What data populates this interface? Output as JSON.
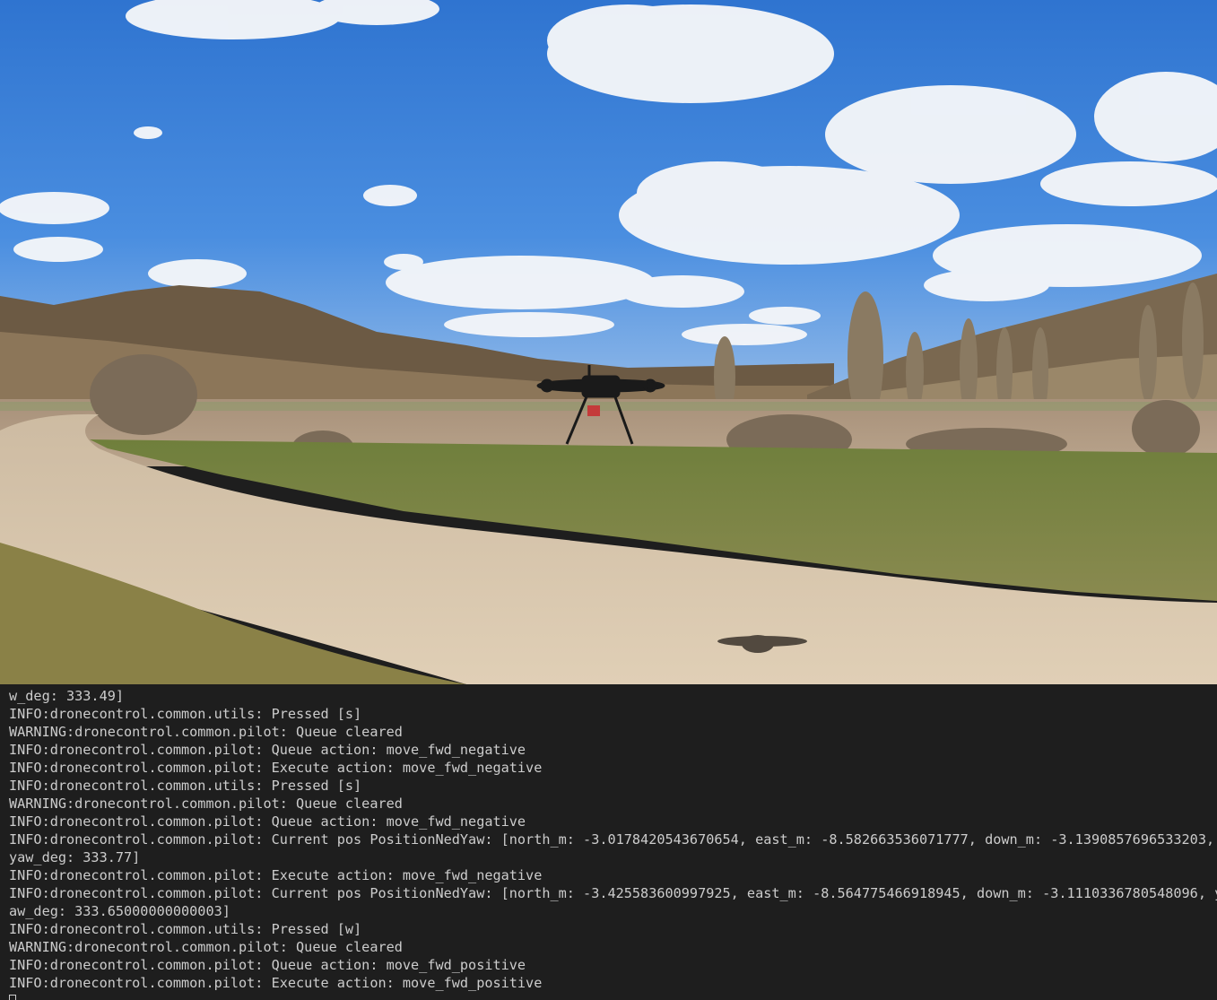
{
  "photo": {
    "subject": "drone-over-field-photo",
    "sky_color": "#3b7fd6",
    "field_color": "#b9a48c",
    "road_color": "#d9c8b0",
    "grass_color": "#7d8f4a"
  },
  "terminal": {
    "background": "#1e1e1e",
    "text_color": "#cccccc",
    "lines": [
      "w_deg: 333.49]",
      "INFO:dronecontrol.common.utils: Pressed [s]",
      "WARNING:dronecontrol.common.pilot: Queue cleared",
      "INFO:dronecontrol.common.pilot: Queue action: move_fwd_negative",
      "INFO:dronecontrol.common.pilot: Execute action: move_fwd_negative",
      "INFO:dronecontrol.common.utils: Pressed [s]",
      "WARNING:dronecontrol.common.pilot: Queue cleared",
      "INFO:dronecontrol.common.pilot: Queue action: move_fwd_negative",
      "INFO:dronecontrol.common.pilot: Current pos PositionNedYaw: [north_m: -3.0178420543670654, east_m: -8.582663536071777, down_m: -3.1390857696533203,",
      "yaw_deg: 333.77]",
      "INFO:dronecontrol.common.pilot: Execute action: move_fwd_negative",
      "INFO:dronecontrol.common.pilot: Current pos PositionNedYaw: [north_m: -3.425583600997925, east_m: -8.564775466918945, down_m: -3.1110336780548096, y",
      "aw_deg: 333.65000000000003]",
      "INFO:dronecontrol.common.utils: Pressed [w]",
      "WARNING:dronecontrol.common.pilot: Queue cleared",
      "INFO:dronecontrol.common.pilot: Queue action: move_fwd_positive",
      "INFO:dronecontrol.common.pilot: Execute action: move_fwd_positive"
    ]
  }
}
